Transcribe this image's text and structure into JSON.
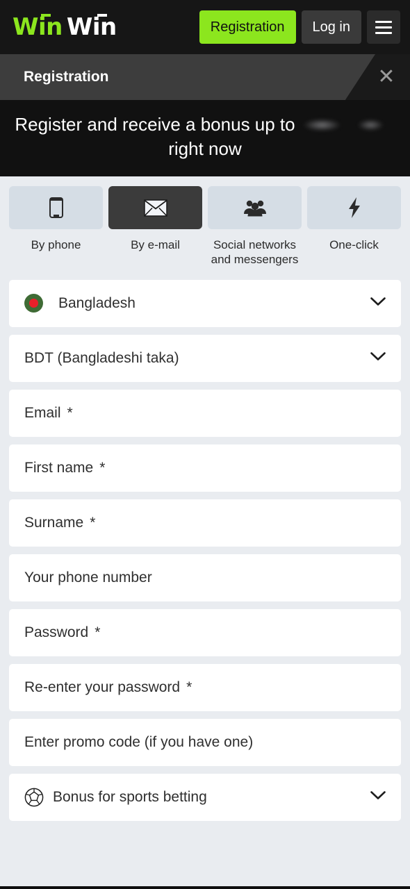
{
  "topbar": {
    "logo_part1": "Win",
    "logo_part2": "Win",
    "register_label": "Registration",
    "login_label": "Log in",
    "menu_icon": "hamburger-menu-icon"
  },
  "modal": {
    "tab_label": "Registration",
    "close_label": "✕"
  },
  "banner": {
    "text_before": "Register and receive a bonus up to",
    "amount": "",
    "text_after": "right now"
  },
  "methods": [
    {
      "label": "By phone",
      "icon": "phone-icon",
      "active": false
    },
    {
      "label": "By e-mail",
      "icon": "envelope-icon",
      "active": true
    },
    {
      "label": "Social networks and messengers",
      "icon": "people-group-icon",
      "active": false
    },
    {
      "label": "One-click",
      "icon": "lightning-bolt-icon",
      "active": false
    }
  ],
  "form": {
    "country": {
      "value": "Bangladesh",
      "flag": "bangladesh-flag-icon",
      "chevron": "chevron-down-icon"
    },
    "currency": {
      "value": "BDT (Bangladeshi taka)",
      "chevron": "chevron-down-icon"
    },
    "fields": [
      {
        "placeholder": "Email",
        "required": "*"
      },
      {
        "placeholder": "First name",
        "required": "*"
      },
      {
        "placeholder": "Surname",
        "required": "*"
      },
      {
        "placeholder": "Your phone number",
        "required": ""
      },
      {
        "placeholder": "Password",
        "required": "*"
      },
      {
        "placeholder": "Re-enter your password",
        "required": "*"
      },
      {
        "placeholder": "Enter promo code (if you have one)",
        "required": ""
      }
    ],
    "bonus": {
      "value": "Bonus for sports betting",
      "icon": "football-ball-icon",
      "chevron": "chevron-down-icon"
    }
  },
  "colors": {
    "accent_green": "#8ce61e",
    "page_bg": "#e9ecf0",
    "dark_bg": "#161616",
    "tile_inactive": "#d5dde5",
    "tile_active": "#3b3b3b",
    "flag_green": "#3f6b35",
    "flag_red": "#e8202a"
  }
}
